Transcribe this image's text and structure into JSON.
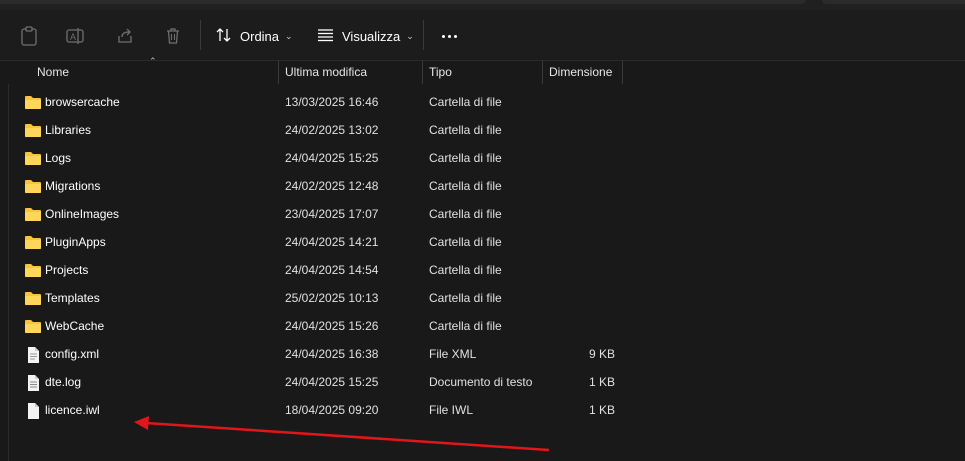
{
  "toolbar": {
    "icons": [
      "paste-icon",
      "rename-icon",
      "share-icon",
      "delete-icon"
    ],
    "sort_label": "Ordina",
    "view_label": "Visualizza",
    "more_label": "..."
  },
  "columns": {
    "name": "Nome",
    "modified": "Ultima modifica",
    "type": "Tipo",
    "size": "Dimensione"
  },
  "files": [
    {
      "name": "browsercache",
      "modified": "13/03/2025 16:46",
      "type": "Cartella di file",
      "size": "",
      "icon": "folder-icon"
    },
    {
      "name": "Libraries",
      "modified": "24/02/2025 13:02",
      "type": "Cartella di file",
      "size": "",
      "icon": "folder-icon"
    },
    {
      "name": "Logs",
      "modified": "24/04/2025 15:25",
      "type": "Cartella di file",
      "size": "",
      "icon": "folder-icon"
    },
    {
      "name": "Migrations",
      "modified": "24/02/2025 12:48",
      "type": "Cartella di file",
      "size": "",
      "icon": "folder-icon"
    },
    {
      "name": "OnlineImages",
      "modified": "23/04/2025 17:07",
      "type": "Cartella di file",
      "size": "",
      "icon": "folder-icon"
    },
    {
      "name": "PluginApps",
      "modified": "24/04/2025 14:21",
      "type": "Cartella di file",
      "size": "",
      "icon": "folder-icon"
    },
    {
      "name": "Projects",
      "modified": "24/04/2025 14:54",
      "type": "Cartella di file",
      "size": "",
      "icon": "folder-icon"
    },
    {
      "name": "Templates",
      "modified": "25/02/2025 10:13",
      "type": "Cartella di file",
      "size": "",
      "icon": "folder-icon"
    },
    {
      "name": "WebCache",
      "modified": "24/04/2025 15:26",
      "type": "Cartella di file",
      "size": "",
      "icon": "folder-icon"
    },
    {
      "name": "config.xml",
      "modified": "24/04/2025 16:38",
      "type": "File XML",
      "size": "9 KB",
      "icon": "xml-file-icon"
    },
    {
      "name": "dte.log",
      "modified": "24/04/2025 15:25",
      "type": "Documento di testo",
      "size": "1 KB",
      "icon": "text-file-icon"
    },
    {
      "name": "licence.iwl",
      "modified": "18/04/2025 09:20",
      "type": "File IWL",
      "size": "1 KB",
      "icon": "file-icon"
    }
  ],
  "colors": {
    "background": "#191919",
    "folder": "#f5c542",
    "annotation_arrow": "#e0161a"
  }
}
